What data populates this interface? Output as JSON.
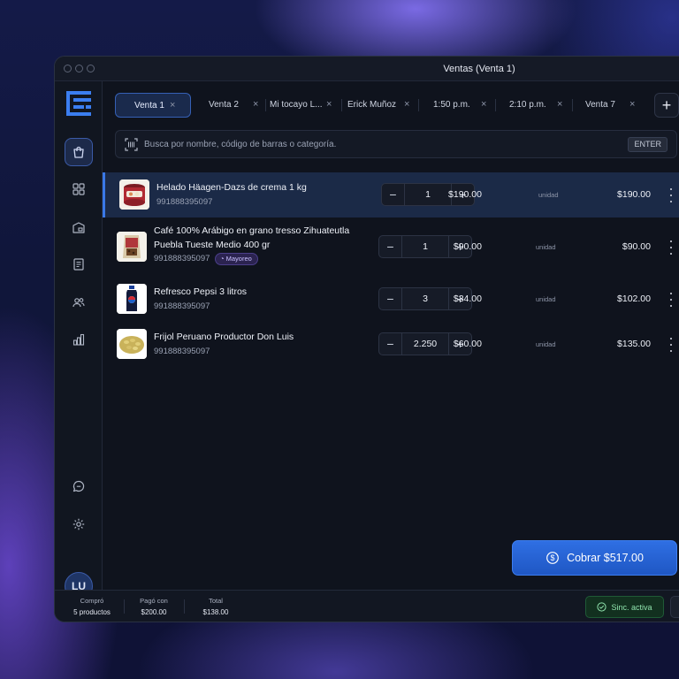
{
  "window": {
    "title": "Ventas (Venta 1)"
  },
  "sidebar": {
    "items": [
      {
        "name": "ventas",
        "icon": "shopping-bag-icon",
        "active": true
      },
      {
        "name": "catalogo",
        "icon": "grid-icon",
        "active": false
      },
      {
        "name": "inventario",
        "icon": "warehouse-icon",
        "active": false
      },
      {
        "name": "reportes",
        "icon": "receipt-icon",
        "active": false
      },
      {
        "name": "clientes",
        "icon": "users-icon",
        "active": false
      },
      {
        "name": "estadisticas",
        "icon": "bar-chart-icon",
        "active": false
      }
    ],
    "bottom": [
      {
        "name": "soporte",
        "icon": "chat-icon"
      },
      {
        "name": "ajustes",
        "icon": "gear-icon"
      }
    ],
    "avatar": "LU"
  },
  "tabs": [
    {
      "label": "Venta 1",
      "active": true
    },
    {
      "label": "Venta 2",
      "active": false
    },
    {
      "label": "Mi tocayo L...",
      "active": false
    },
    {
      "label": "Erick Muñoz",
      "active": false
    },
    {
      "label": "1:50 p.m.",
      "active": false
    },
    {
      "label": "2:10 p.m.",
      "active": false
    },
    {
      "label": "Venta 7",
      "active": false
    }
  ],
  "tab_close_glyph": "×",
  "add_tab_glyph": "+",
  "search": {
    "placeholder": "Busca por nombre, código de barras o categoría.",
    "key_hint": "ENTER"
  },
  "items": [
    {
      "name": "Helado Häagen-Dazs de crema 1 kg",
      "sku": "991888395097",
      "tag": "",
      "qty": "1",
      "price": "$190.00",
      "unit": "unidad",
      "total": "$190.00",
      "selected": true
    },
    {
      "name": "Café 100% Arábigo en grano tresso Zihuateutla Puebla Tueste Medio 400 gr",
      "sku": "991888395097",
      "tag": "Mayoreo",
      "qty": "1",
      "price": "$90.00",
      "unit": "unidad",
      "total": "$90.00",
      "selected": false
    },
    {
      "name": "Refresco Pepsi 3 litros",
      "sku": "991888395097",
      "tag": "",
      "qty": "3",
      "price": "$34.00",
      "unit": "unidad",
      "total": "$102.00",
      "selected": false
    },
    {
      "name": "Frijol Peruano Productor Don Luis",
      "sku": "991888395097",
      "tag": "",
      "qty": "2.250",
      "price": "$60.00",
      "unit": "unidad",
      "total": "$135.00",
      "selected": false
    }
  ],
  "checkout": {
    "label": "Cobrar $517.00"
  },
  "footer": {
    "compro_label": "Compró",
    "compro_value": "5 productos",
    "pago_label": "Pagó con",
    "pago_value": "$200.00",
    "total_label": "Total",
    "total_value": "$138.00",
    "sync_label": "Sinc. activa"
  },
  "colors": {
    "accent": "#2f6fe3",
    "selected_row": "#1b2a47",
    "sync_green": "#8fe2ac",
    "tag_purple": "#c9c1ff"
  }
}
